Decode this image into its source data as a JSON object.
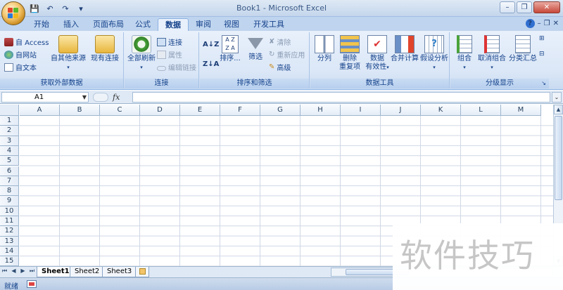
{
  "window": {
    "title": "Book1 - Microsoft Excel",
    "minimize": "–",
    "restore": "❐",
    "close": "✕"
  },
  "qat": {
    "save": "💾",
    "undo": "↶",
    "redo": "↷",
    "customize": "▾"
  },
  "tabs": [
    {
      "label": "开始"
    },
    {
      "label": "插入"
    },
    {
      "label": "页面布局"
    },
    {
      "label": "公式"
    },
    {
      "label": "数据",
      "active": true
    },
    {
      "label": "审阅"
    },
    {
      "label": "视图"
    },
    {
      "label": "开发工具"
    }
  ],
  "ribbon_right": {
    "help": "?",
    "min": "–",
    "restore": "❐",
    "close": "✕"
  },
  "ribbon": {
    "external": {
      "label": "获取外部数据",
      "access": "自 Access",
      "web": "自网站",
      "text": "自文本",
      "other": "自其他来源",
      "existing": "现有连接"
    },
    "connections": {
      "label": "连接",
      "refresh_all": "全部刷新",
      "connections": "连接",
      "properties": "属性",
      "edit_links": "编辑链接"
    },
    "sort_filter": {
      "label": "排序和筛选",
      "sort": "排序...",
      "filter": "筛选",
      "clear": "清除",
      "reapply": "重新应用",
      "advanced": "高级"
    },
    "data_tools": {
      "label": "数据工具",
      "text_to_columns": "分列",
      "remove_duplicates_1": "删除",
      "remove_duplicates_2": "重复项",
      "validation_1": "数据",
      "validation_2": "有效性",
      "consolidate": "合并计算",
      "what_if": "假设分析"
    },
    "outline": {
      "label": "分级显示",
      "group": "组合",
      "ungroup": "取消组合",
      "subtotal": "分类汇总"
    }
  },
  "formula_bar": {
    "name_box": "A1",
    "fx": "fx",
    "value": ""
  },
  "columns": [
    "A",
    "B",
    "C",
    "D",
    "E",
    "F",
    "G",
    "H",
    "I",
    "J",
    "K",
    "L",
    "M"
  ],
  "rows": [
    "1",
    "2",
    "3",
    "4",
    "5",
    "6",
    "7",
    "8",
    "9",
    "10",
    "11",
    "12",
    "13",
    "14",
    "15"
  ],
  "sheets": [
    {
      "label": "Sheet1",
      "active": true
    },
    {
      "label": "Sheet2"
    },
    {
      "label": "Sheet3"
    }
  ],
  "status": {
    "ready": "就绪"
  },
  "watermark": "软件技巧"
}
